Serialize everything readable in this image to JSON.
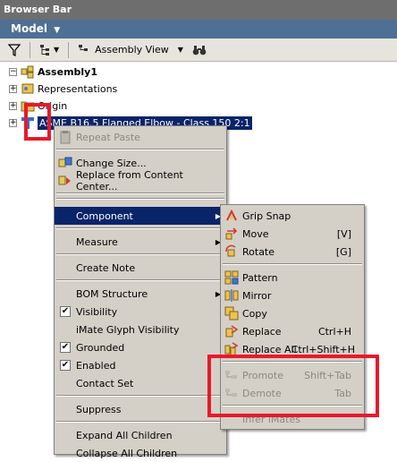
{
  "title_bar": {
    "title": "Browser Bar"
  },
  "model_bar": {
    "label": "Model"
  },
  "toolbar": {
    "view_label": "Assembly View"
  },
  "tree": {
    "root": "Assembly1",
    "items": [
      {
        "label": "Representations"
      },
      {
        "label": "Origin"
      },
      {
        "label": "ASME B16.5 Flanged Elbow - Class 150 2:1"
      }
    ]
  },
  "context_menu": {
    "repeat_paste": "Repeat Paste",
    "change_size": "Change Size...",
    "replace_cc": "Replace from Content Center...",
    "component": "Component",
    "measure": "Measure",
    "create_note": "Create Note",
    "bom_structure": "BOM Structure",
    "visibility": "Visibility",
    "imate_glyph": "iMate Glyph Visibility",
    "grounded": "Grounded",
    "enabled": "Enabled",
    "contact_set": "Contact Set",
    "suppress": "Suppress",
    "expand_all": "Expand All Children",
    "collapse_all": "Collapse All Children"
  },
  "component_submenu": {
    "grip_snap": "Grip Snap",
    "move": "Move",
    "move_key": "[V]",
    "rotate": "Rotate",
    "rotate_key": "[G]",
    "pattern": "Pattern",
    "mirror": "Mirror",
    "copy": "Copy",
    "replace": "Replace",
    "replace_key": "Ctrl+H",
    "replace_all": "Replace All",
    "replace_all_key": "Ctrl+Shift+H",
    "promote": "Promote",
    "promote_key": "Shift+Tab",
    "demote": "Demote",
    "demote_key": "Tab",
    "infer_imates": "Infer iMates"
  },
  "colors": {
    "highlight_red": "#e8192c",
    "selection_blue": "#0a246a",
    "menu_bg": "#d4d0c8"
  }
}
